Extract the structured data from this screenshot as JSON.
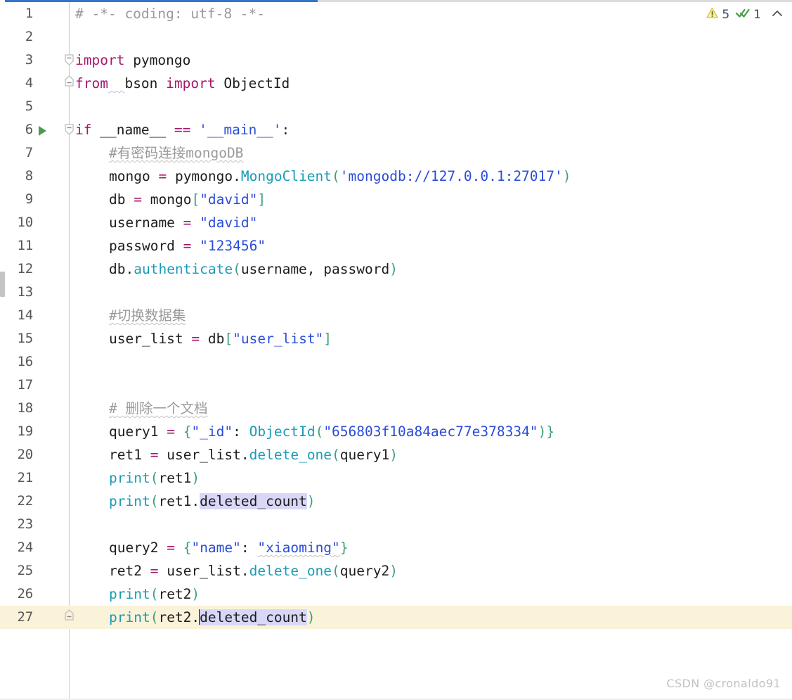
{
  "editor": {
    "language": "Python",
    "accent_color": "#3574c8",
    "current_line": 27,
    "caret_line": 27,
    "gutter_separator_color": "#d4d4d4",
    "current_line_highlight": "#faf3da",
    "occurrence_highlight": "#d9d7f7"
  },
  "inspection_widget": {
    "warning_icon": "warning-triangle-icon",
    "warning_count": "5",
    "ok_icon": "double-check-icon",
    "ok_count": "1",
    "collapse_icon": "chevron-up-icon"
  },
  "watermark": {
    "text": "CSDN @cronaldo91"
  },
  "lines": [
    {
      "n": "1",
      "run": false,
      "fold": "",
      "indent": 0
    },
    {
      "n": "2",
      "run": false,
      "fold": "",
      "indent": 0
    },
    {
      "n": "3",
      "run": false,
      "fold": "down",
      "indent": 0
    },
    {
      "n": "4",
      "run": false,
      "fold": "up",
      "indent": 0
    },
    {
      "n": "5",
      "run": false,
      "fold": "",
      "indent": 0
    },
    {
      "n": "6",
      "run": true,
      "fold": "down",
      "indent": 0
    },
    {
      "n": "7",
      "run": false,
      "fold": "",
      "indent": 1
    },
    {
      "n": "8",
      "run": false,
      "fold": "",
      "indent": 1
    },
    {
      "n": "9",
      "run": false,
      "fold": "",
      "indent": 1
    },
    {
      "n": "10",
      "run": false,
      "fold": "",
      "indent": 1
    },
    {
      "n": "11",
      "run": false,
      "fold": "",
      "indent": 1
    },
    {
      "n": "12",
      "run": false,
      "fold": "",
      "indent": 1
    },
    {
      "n": "13",
      "run": false,
      "fold": "",
      "indent": 1
    },
    {
      "n": "14",
      "run": false,
      "fold": "",
      "indent": 1
    },
    {
      "n": "15",
      "run": false,
      "fold": "",
      "indent": 1
    },
    {
      "n": "16",
      "run": false,
      "fold": "",
      "indent": 1
    },
    {
      "n": "17",
      "run": false,
      "fold": "",
      "indent": 1
    },
    {
      "n": "18",
      "run": false,
      "fold": "",
      "indent": 1
    },
    {
      "n": "19",
      "run": false,
      "fold": "",
      "indent": 1
    },
    {
      "n": "20",
      "run": false,
      "fold": "",
      "indent": 1
    },
    {
      "n": "21",
      "run": false,
      "fold": "",
      "indent": 1
    },
    {
      "n": "22",
      "run": false,
      "fold": "",
      "indent": 1
    },
    {
      "n": "23",
      "run": false,
      "fold": "",
      "indent": 1
    },
    {
      "n": "24",
      "run": false,
      "fold": "",
      "indent": 1
    },
    {
      "n": "25",
      "run": false,
      "fold": "",
      "indent": 1
    },
    {
      "n": "26",
      "run": false,
      "fold": "",
      "indent": 1
    },
    {
      "n": "27",
      "run": false,
      "fold": "up",
      "indent": 1
    }
  ],
  "code_text": {
    "l1": "# -*- coding: utf-8 -*-",
    "l2": "",
    "l3": "import pymongo",
    "l4": "from  bson import ObjectId",
    "l5": "",
    "l6": "if __name__ == '__main__':",
    "l7": "    #有密码连接mongoDB",
    "l8": "    mongo = pymongo.MongoClient('mongodb://127.0.0.1:27017')",
    "l9": "    db = mongo[\"david\"]",
    "l10": "    username = \"david\"",
    "l11": "    password = \"123456\"",
    "l12": "    db.authenticate(username, password)",
    "l13": "",
    "l14": "    #切换数据集",
    "l15": "    user_list = db[\"user_list\"]",
    "l16": "",
    "l17": "",
    "l18": "    # 删除一个文档",
    "l19": "    query1 = {\"_id\": ObjectId(\"656803f10a84aec77e378334\")}",
    "l20": "    ret1 = user_list.delete_one(query1)",
    "l21": "    print(ret1)",
    "l22": "    print(ret1.deleted_count)",
    "l23": "",
    "l24": "    query2 = {\"name\": \"xiaoming\"}",
    "l25": "    ret2 = user_list.delete_one(query2)",
    "l26": "    print(ret2)",
    "l27": "    print(ret2.deleted_count)"
  },
  "tokens": {
    "comment_header": "# -*- coding: utf-8 -*-",
    "kw_import": "import",
    "mod_pymongo": " pymongo",
    "kw_from": "from",
    "from_gap": "  ",
    "mod_bson": "bson",
    "kw_import2": "import",
    "cls_objectid": "ObjectId",
    "kw_if": "if",
    "name_dunder": " __name__ ",
    "op_eq": "==",
    "str_main": "'__main__'",
    "colon": ":",
    "cmt_conn": "#有密码连接mongoDB",
    "var_mongo": "mongo",
    "eq": "=",
    "mod_pymongo_2": "pymongo",
    "dot": ".",
    "fn_mongoclient": "MongoClient",
    "paren_open": "(",
    "str_uri": "'mongodb://127.0.0.1:27017'",
    "paren_close": ")",
    "var_db": "db",
    "brk_open": "[",
    "str_david_key": "\"david\"",
    "brk_close": "]",
    "var_username": "username",
    "str_david": "\"david\"",
    "var_password": "password",
    "str_123456": "\"123456\"",
    "fn_authenticate": "authenticate",
    "args_userpass": "username, password",
    "cmt_switch": "#切换数据集",
    "var_user_list": "user_list",
    "str_user_list": "\"user_list\"",
    "cmt_delete_one_doc": "# 删除一个文档",
    "var_query1": "query1",
    "brace_open": "{",
    "str_id": "\"_id\"",
    "colon_sp": ": ",
    "str_oid": "\"656803f10a84aec77e378334\"",
    "brace_close": "}",
    "var_ret1": "ret1",
    "fn_delete_one": "delete_one",
    "fn_print": "print",
    "attr_deleted_count": "deleted_count",
    "var_query2": "query2",
    "str_name": "\"name\"",
    "str_xiaoming": "\"xiaoming\"",
    "var_ret2": "ret2"
  }
}
